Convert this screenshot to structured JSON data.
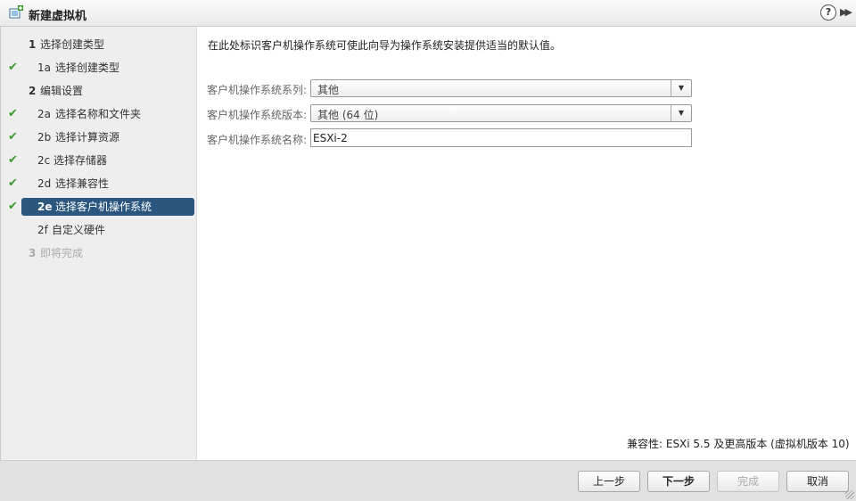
{
  "window": {
    "title": "新建虚拟机",
    "help_label": "?",
    "expand_label": "▶▶"
  },
  "sidebar": {
    "steps": [
      {
        "num": "1",
        "label": "选择创建类型",
        "check": false
      },
      {
        "num": "1a",
        "label": "选择创建类型",
        "check": true
      },
      {
        "num": "2",
        "label": "编辑设置",
        "check": false
      },
      {
        "num": "2a",
        "label": "选择名称和文件夹",
        "check": true
      },
      {
        "num": "2b",
        "label": "选择计算资源",
        "check": true
      },
      {
        "num": "2c",
        "label": "选择存储器",
        "check": true
      },
      {
        "num": "2d",
        "label": "选择兼容性",
        "check": true
      },
      {
        "num": "2e",
        "label": "选择客户机操作系统",
        "check": true
      },
      {
        "num": "2f",
        "label": "自定义硬件",
        "check": false
      },
      {
        "num": "3",
        "label": "即将完成",
        "check": false
      }
    ],
    "check_glyph": "✔"
  },
  "main": {
    "intro": "在此处标识客户机操作系统可使此向导为操作系统安装提供适当的默认值。",
    "fields": {
      "family_label": "客户机操作系统系列:",
      "family_value": "其他",
      "version_label": "客户机操作系统版本:",
      "version_value": "其他 (64 位)",
      "name_label": "客户机操作系统名称:",
      "name_value": "ESXi-2"
    },
    "dropdown_arrow": "▼",
    "compatibility": "兼容性: ESXi 5.5 及更高版本 (虚拟机版本 10)"
  },
  "footer": {
    "back_label": "上一步",
    "next_label": "下一步",
    "finish_label": "完成",
    "cancel_label": "取消"
  }
}
